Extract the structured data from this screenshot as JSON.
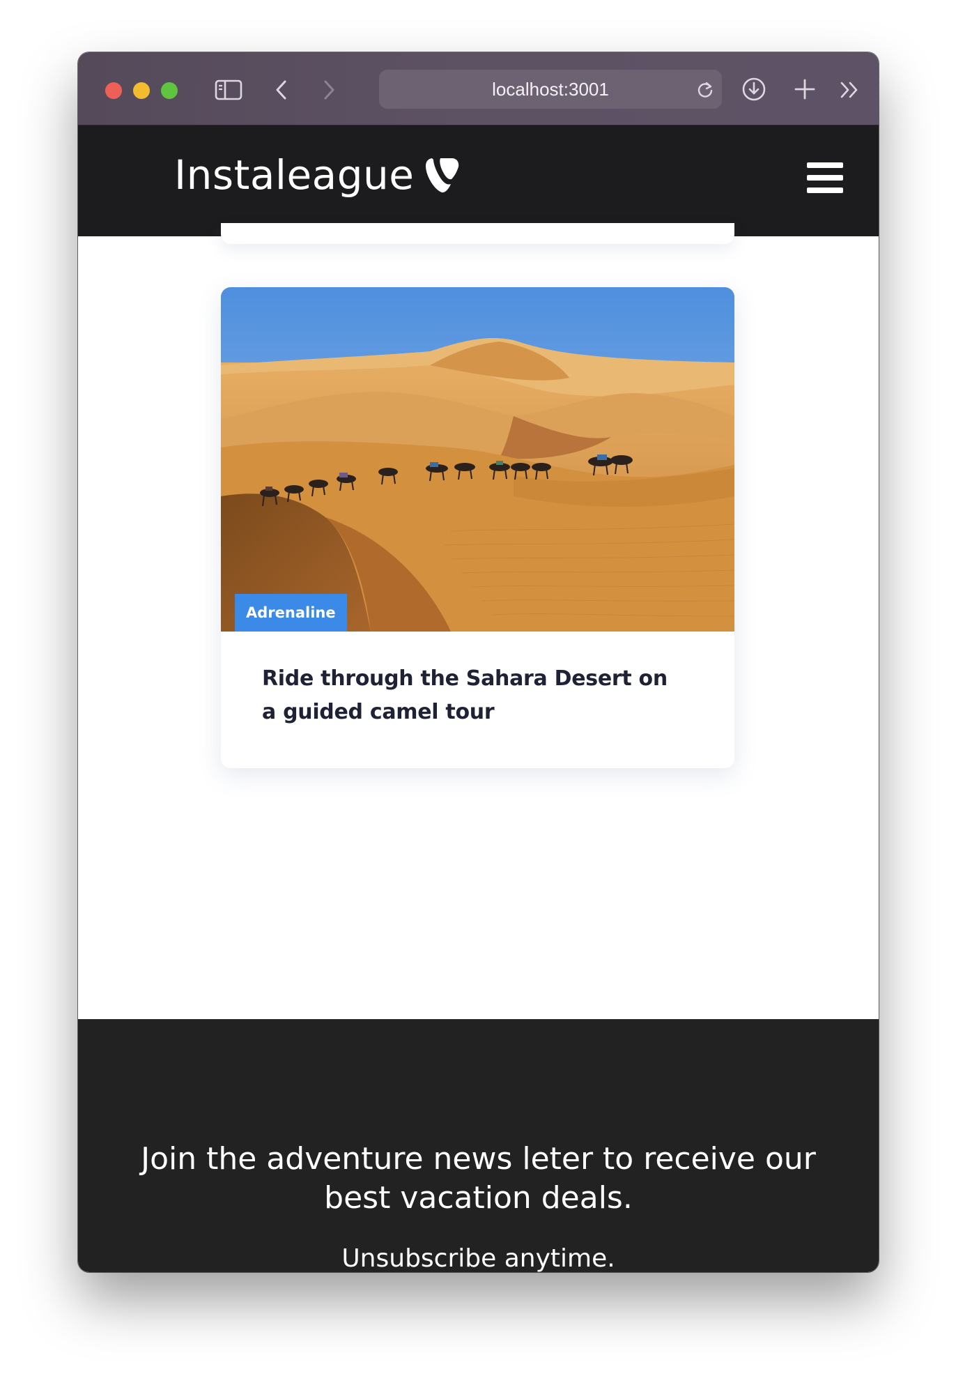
{
  "browser": {
    "url": "localhost:3001",
    "icons": {
      "sidebar": "sidebar-icon",
      "back": "chevron-left-icon",
      "forward": "chevron-right-icon",
      "reload": "reload-icon",
      "download": "download-icon",
      "new_tab": "plus-icon",
      "more": "double-chevron-right-icon"
    }
  },
  "header": {
    "brand_name": "Instaleague",
    "logo_icon": "typo3-logo-icon",
    "menu_icon": "hamburger-menu-icon"
  },
  "card": {
    "category": "Adrenaline",
    "title": "Ride through the Sahara Desert on a guided camel tour",
    "image": "desert-dunes-camel-caravan-photo"
  },
  "footer": {
    "headline": "Join the adventure news leter to receive our best vacation deals.",
    "subtext": "Unsubscribe anytime."
  },
  "colors": {
    "header_bg": "#1c1b1d",
    "footer_bg": "#232223",
    "badge_bg": "#3b8ae8",
    "title_text": "#1e2234"
  }
}
